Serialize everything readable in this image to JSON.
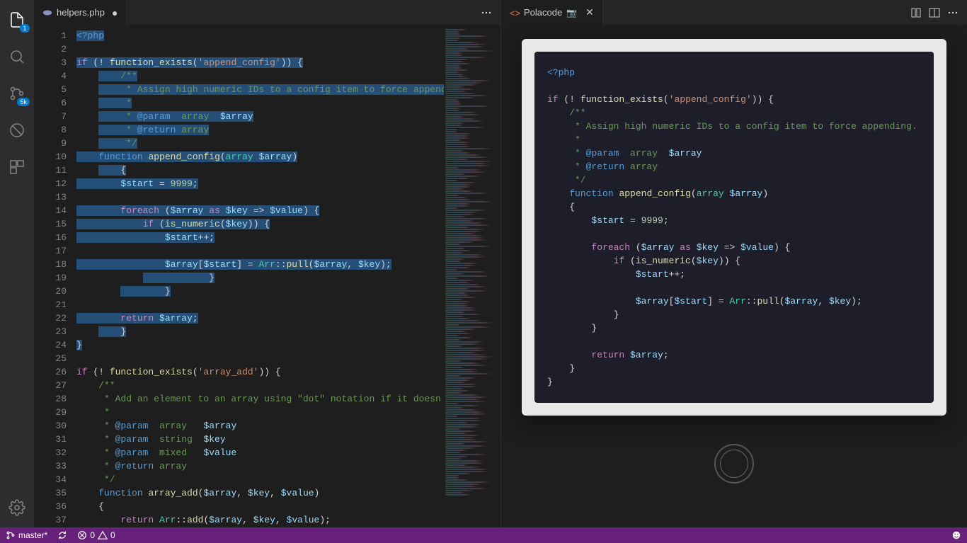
{
  "activitybar": {
    "explorer_badge": "1",
    "scm_badge": "5k"
  },
  "editor_left": {
    "tab_label": "helpers.php",
    "line_numbers": [
      "1",
      "2",
      "3",
      "4",
      "5",
      "6",
      "7",
      "8",
      "9",
      "10",
      "11",
      "12",
      "13",
      "14",
      "15",
      "16",
      "17",
      "18",
      "19",
      "20",
      "21",
      "22",
      "23",
      "24",
      "25",
      "26",
      "27",
      "28",
      "29",
      "30",
      "31",
      "32",
      "33",
      "34",
      "35",
      "36",
      "37"
    ]
  },
  "editor_right": {
    "tab_label": "Polacode"
  },
  "statusbar": {
    "branch": "master*",
    "errors": "0",
    "warnings": "0"
  },
  "code": {
    "l1": "<?php",
    "l3a": "if",
    "l3b": " (! ",
    "l3c": "function_exists",
    "l3d": "(",
    "l3e": "'append_config'",
    "l3f": ")) {",
    "l4": "    /**",
    "l5": "     * Assign high numeric IDs to a config item to force appending.",
    "l6": "     *",
    "l7a": "     * ",
    "l7b": "@param",
    "l7c": "  array  ",
    "l7d": "$array",
    "l8a": "     * ",
    "l8b": "@return",
    "l8c": " array",
    "l9": "     */",
    "l10a": "    ",
    "l10b": "function",
    "l10c": " ",
    "l10d": "append_config",
    "l10e": "(",
    "l10f": "array",
    "l10g": " ",
    "l10h": "$array",
    "l10i": ")",
    "l11": "    {",
    "l12a": "        ",
    "l12b": "$start",
    "l12c": " = ",
    "l12d": "9999",
    "l12e": ";",
    "l14a": "        ",
    "l14b": "foreach",
    "l14c": " (",
    "l14d": "$array",
    "l14e": " ",
    "l14f": "as",
    "l14g": " ",
    "l14h": "$key",
    "l14i": " => ",
    "l14j": "$value",
    "l14k": ") {",
    "l15a": "            ",
    "l15b": "if",
    "l15c": " (",
    "l15d": "is_numeric",
    "l15e": "(",
    "l15f": "$key",
    "l15g": ")) {",
    "l16a": "                ",
    "l16b": "$start",
    "l16c": "++;",
    "l18a": "                ",
    "l18b": "$array",
    "l18c": "[",
    "l18d": "$start",
    "l18e": "] = ",
    "l18f": "Arr",
    "l18g": "::",
    "l18h": "pull",
    "l18i": "(",
    "l18j": "$array",
    "l18k": ", ",
    "l18l": "$key",
    "l18m": ");",
    "l19": "            }",
    "l20": "        }",
    "l22a": "        ",
    "l22b": "return",
    "l22c": " ",
    "l22d": "$array",
    "l22e": ";",
    "l23": "    }",
    "l24": "}",
    "l26a": "if",
    "l26b": " (! ",
    "l26c": "function_exists",
    "l26d": "(",
    "l26e": "'array_add'",
    "l26f": ")) {",
    "l27": "    /**",
    "l28": "     * Add an element to an array using \"dot\" notation if it doesn",
    "l29": "     *",
    "l30a": "     * ",
    "l30b": "@param",
    "l30c": "  array   ",
    "l30d": "$array",
    "l31a": "     * ",
    "l31b": "@param",
    "l31c": "  string  ",
    "l31d": "$key",
    "l32a": "     * ",
    "l32b": "@param",
    "l32c": "  mixed   ",
    "l32d": "$value",
    "l33a": "     * ",
    "l33b": "@return",
    "l33c": " array",
    "l34": "     */",
    "l35a": "    ",
    "l35b": "function",
    "l35c": " ",
    "l35d": "array_add",
    "l35e": "(",
    "l35f": "$array",
    "l35g": ", ",
    "l35h": "$key",
    "l35i": ", ",
    "l35j": "$value",
    "l35k": ")",
    "l36": "    {",
    "l37a": "        ",
    "l37b": "return",
    "l37c": " ",
    "l37d": "Arr",
    "l37e": "::",
    "l37f": "add",
    "l37g": "(",
    "l37h": "$array",
    "l37i": ", ",
    "l37j": "$key",
    "l37k": ", ",
    "l37l": "$value",
    "l37m": ");"
  }
}
